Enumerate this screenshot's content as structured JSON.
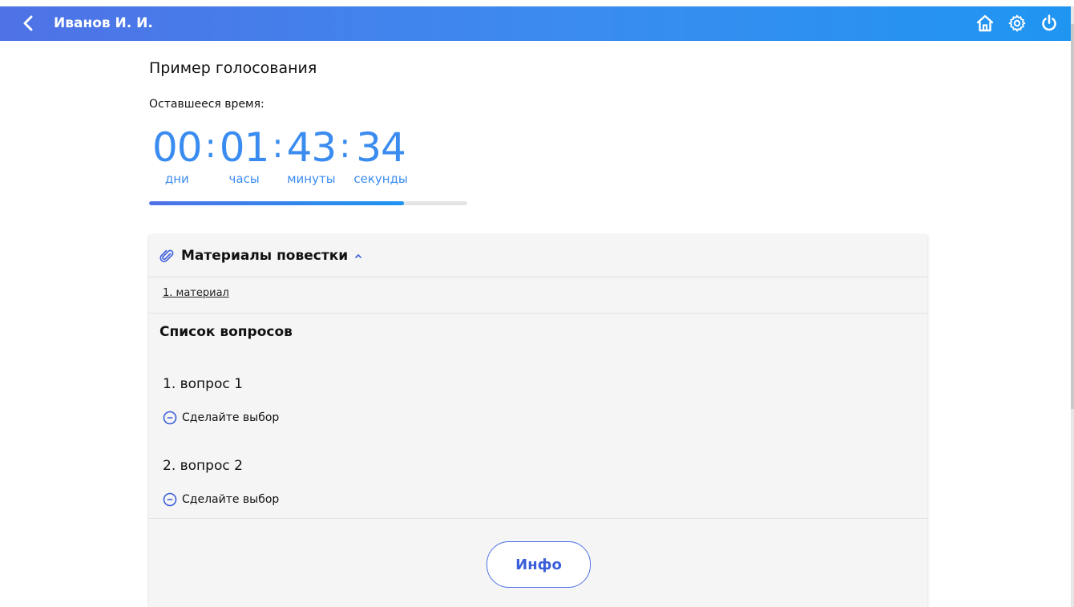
{
  "header": {
    "user_name": "Иванов И. И.",
    "icons": [
      "back-icon",
      "home-icon",
      "gear-icon",
      "power-icon"
    ]
  },
  "vote": {
    "title": "Пример голосования",
    "remaining_label": "Оставшееся время:",
    "timer": {
      "days": "00",
      "hours": "01",
      "minutes": "43",
      "seconds": "34",
      "separator": ":",
      "days_label": "дни",
      "hours_label": "часы",
      "minutes_label": "минуты",
      "seconds_label": "секунды"
    },
    "progress_fraction": 0.8
  },
  "materials": {
    "title": "Материалы повестки",
    "items": [
      "1. материал"
    ]
  },
  "questions": {
    "heading": "Список вопросов",
    "items": [
      {
        "title": "1. вопрос 1",
        "choice_label": "Сделайте выбор"
      },
      {
        "title": "2. вопрос 2",
        "choice_label": "Сделайте выбор"
      }
    ]
  },
  "info_button": "Инфо",
  "colors": {
    "accent": "#3a8cf0",
    "accent_dark": "#4f72e6",
    "button_text": "#3b5fd9"
  }
}
